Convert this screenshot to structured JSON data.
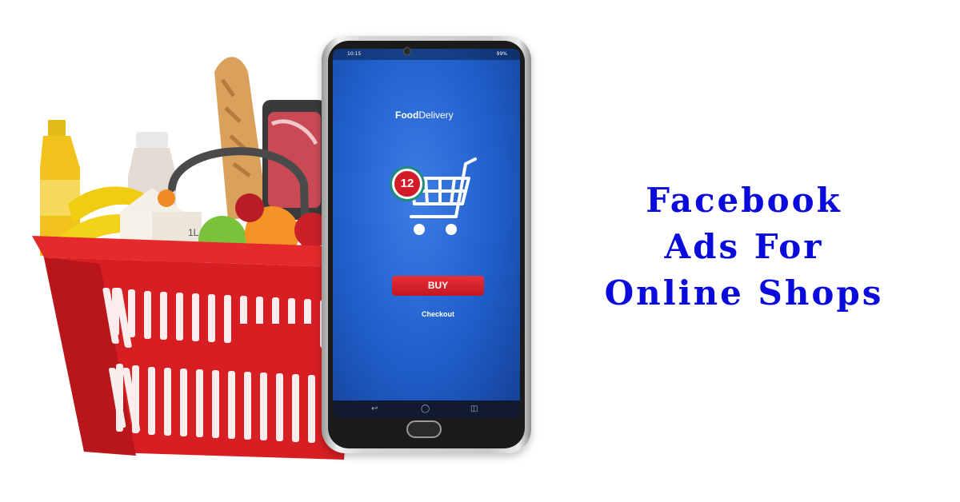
{
  "headline": {
    "line1": "Facebook",
    "line2": "Ads For",
    "line3": "Online Shops",
    "color": "#0a0adc"
  },
  "phone": {
    "status_time": "10:15",
    "status_battery": "99%",
    "app_title_bold": "Food",
    "app_title_regular": "Delivery",
    "cart_badge_count": "12",
    "buy_label": "BUY",
    "checkout_label": "Checkout",
    "nav_icons": [
      "back-icon",
      "home-icon",
      "recents-icon"
    ],
    "screen_color": "#1f5ec9",
    "buy_color": "#d31c2a"
  },
  "illustration": {
    "basket_color": "#d71f23",
    "milk_carton_label": "1L"
  }
}
